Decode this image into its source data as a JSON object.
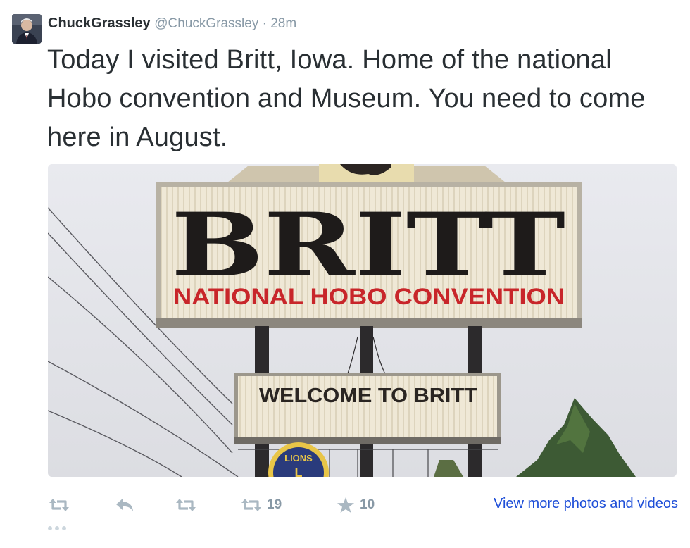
{
  "tweet": {
    "display_name": "ChuckGrassley",
    "handle": "@ChuckGrassley",
    "separator": " · ",
    "time": "28m",
    "text": "Today I visited Britt, Iowa.  Home of the national Hobo convention and Museum.  You need to come here in August."
  },
  "media": {
    "sign_main": "BRITT",
    "sign_sub": "NATIONAL HOBO CONVENTION",
    "sign_welcome": "WELCOME TO BRITT",
    "emblem_text": "LIONS",
    "emblem_letter": "L"
  },
  "actions": {
    "retweet_count": "19",
    "favorite_count": "10",
    "view_more": "View more photos and videos"
  },
  "icons": {
    "retweet": "retweet-icon",
    "reply": "reply-icon",
    "favorite": "star-icon",
    "more": "more-dots-icon"
  },
  "colors": {
    "link": "#1f4fd8",
    "muted": "#8899a6",
    "sign_red": "#c8262a",
    "sign_black": "#1e1b1a"
  }
}
